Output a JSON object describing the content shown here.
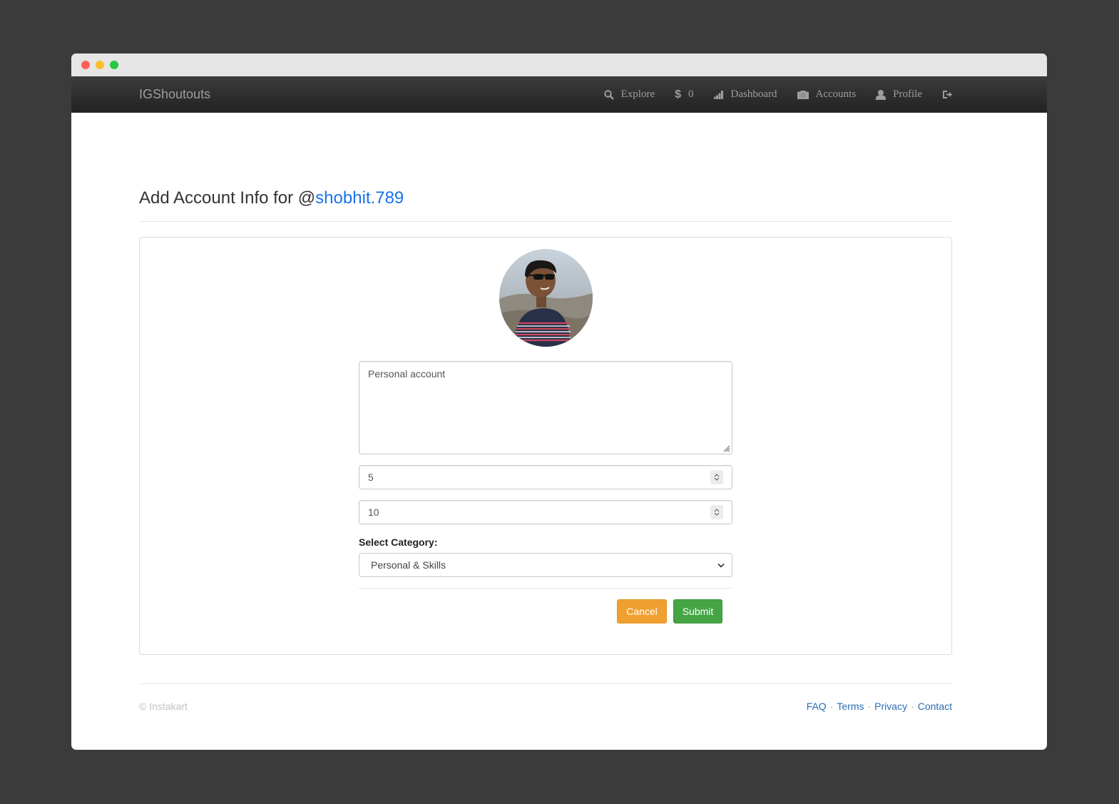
{
  "navbar": {
    "brand": "IGShoutouts",
    "explore": "Explore",
    "balance_symbol": "$",
    "balance": "0",
    "dashboard": "Dashboard",
    "accounts": "Accounts",
    "profile": "Profile"
  },
  "page": {
    "title_prefix": "Add Account Info for @",
    "handle": "shobhit.789"
  },
  "form": {
    "description": "Personal account",
    "field1_value": "5",
    "field2_value": "10",
    "category_label": "Select Category:",
    "category_selected": "Personal & Skills",
    "cancel_label": "Cancel",
    "submit_label": "Submit"
  },
  "footer": {
    "copyright": "© Instakart",
    "links": [
      "FAQ",
      "Terms",
      "Privacy",
      "Contact"
    ],
    "separator": "·"
  },
  "colors": {
    "link": "#1a73e8",
    "cancel": "#f0a030",
    "submit": "#45a545"
  }
}
